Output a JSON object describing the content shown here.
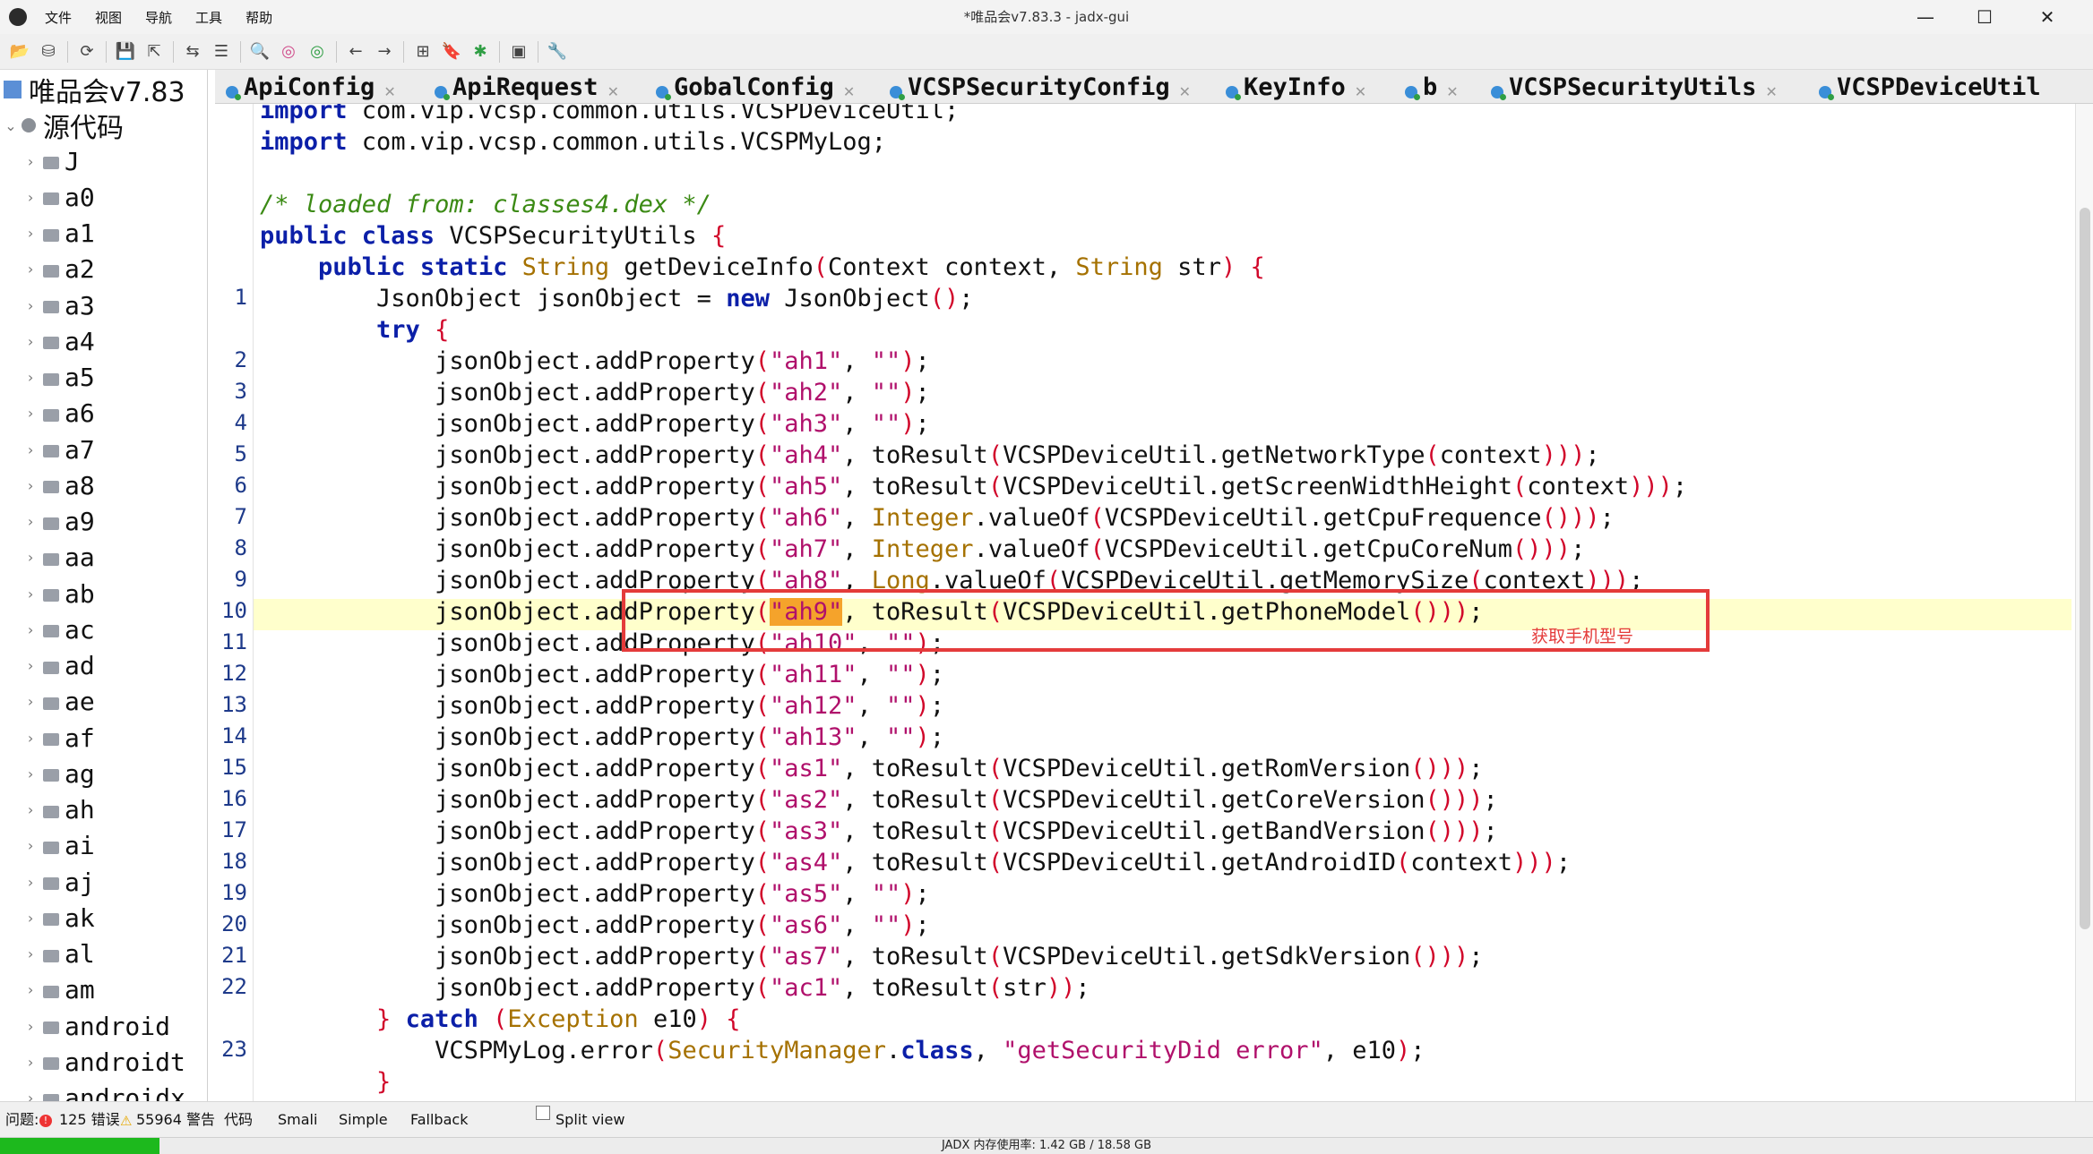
{
  "window": {
    "title": "*唯品会v7.83.3 - jadx-gui",
    "controls": {
      "minimize": "—",
      "maximize": "☐",
      "close": "✕"
    }
  },
  "menu": [
    "文件",
    "视图",
    "导航",
    "工具",
    "帮助"
  ],
  "toolbar_icons": [
    "open-file-icon",
    "save-all-icon",
    "reload-icon",
    "save-icon",
    "export-icon",
    "sync-icon",
    "flatten-icon",
    "search-icon",
    "find-usage-icon",
    "find-class-icon",
    "back-icon",
    "forward-icon",
    "deobfuscation-icon",
    "bookmark-icon",
    "debug-icon",
    "log-icon",
    "preferences-icon"
  ],
  "sidebar": {
    "root_label": "唯品会v7.83",
    "source_label": "源代码",
    "packages": [
      "J",
      "a0",
      "a1",
      "a2",
      "a3",
      "a4",
      "a5",
      "a6",
      "a7",
      "a8",
      "a9",
      "aa",
      "ab",
      "ac",
      "ad",
      "ae",
      "af",
      "ag",
      "ah",
      "ai",
      "aj",
      "ak",
      "al",
      "am",
      "android",
      "androidt",
      "androidx"
    ]
  },
  "tabs": [
    {
      "label": "ApiConfig"
    },
    {
      "label": "ApiRequest"
    },
    {
      "label": "GobalConfig"
    },
    {
      "label": "VCSPSecurityConfig"
    },
    {
      "label": "KeyInfo"
    },
    {
      "label": "b"
    },
    {
      "label": "VCSPSecurityUtils"
    },
    {
      "label": "VCSPDeviceUtil"
    }
  ],
  "line_numbers": [
    "1",
    "2",
    "3",
    "4",
    "5",
    "6",
    "7",
    "8",
    "9",
    "10",
    "11",
    "12",
    "13",
    "14",
    "15",
    "16",
    "17",
    "18",
    "19",
    "20",
    "21",
    "22",
    "23"
  ],
  "code": {
    "kw_import": "import",
    "import1_path": " com.vip.vcsp.common.utils.VCSPDeviceUtil;",
    "import2_path": " com.vip.vcsp.common.utils.VCSPMyLog;",
    "comment": "/* loaded from: classes4.dex */",
    "kw_public_class": "public class",
    "class_name": " VCSPSecurityUtils ",
    "kw_public_static": "public static",
    "type_string": "String",
    "type_context": "Context",
    "type_integer": "Integer",
    "type_long": "Long",
    "method_name": " getDeviceInfo",
    "param_context": " context, ",
    "param_str": " str",
    "local_decl": "JsonObject jsonObject = ",
    "kw_new": "new",
    "new_expr": " JsonObject",
    "kw_try": "try",
    "add_prop": "jsonObject.addProperty",
    "to_result": "toResult",
    "value_of": ".valueOf",
    "util_class": "VCSPDeviceUtil",
    "empty_str": "\"\"",
    "keys": {
      "ah1": "\"ah1\"",
      "ah2": "\"ah2\"",
      "ah3": "\"ah3\"",
      "ah4": "\"ah4\"",
      "ah5": "\"ah5\"",
      "ah6": "\"ah6\"",
      "ah7": "\"ah7\"",
      "ah8": "\"ah8\"",
      "ah9": "\"ah9\"",
      "ah10": "\"ah10\"",
      "ah11": "\"ah11\"",
      "ah12": "\"ah12\"",
      "ah13": "\"ah13\"",
      "as1": "\"as1\"",
      "as2": "\"as2\"",
      "as3": "\"as3\"",
      "as4": "\"as4\"",
      "as5": "\"as5\"",
      "as6": "\"as6\"",
      "as7": "\"as7\"",
      "ac1": "\"ac1\""
    },
    "calls": {
      "network": ".getNetworkType",
      "screen": ".getScreenWidthHeight",
      "cpu_freq": ".getCpuFrequence",
      "cpu_core": ".getCpuCoreNum",
      "memory": ".getMemorySize",
      "phone_model": ".getPhoneModel",
      "rom": ".getRomVersion",
      "core": ".getCoreVersion",
      "band": ".getBandVersion",
      "android_id": ".getAndroidID",
      "sdk": ".getSdkVersion"
    },
    "arg_context": "context",
    "arg_str": "str",
    "kw_catch": "catch",
    "type_exception": "Exception",
    "var_e10": " e10",
    "log_call": "VCSPMyLog.error",
    "sec_manager": "SecurityManager",
    "kw_class": "class",
    "err_msg": "\"getSecurityDid error\"",
    "e10_arg": ", e10"
  },
  "annotation": "获取手机型号",
  "bottom": {
    "issues_label": "问题:",
    "errors": "125 错误",
    "warnings": "55964 警告",
    "view_tabs": [
      "代码",
      "Smali",
      "Simple",
      "Fallback"
    ],
    "split_view": "Split view"
  },
  "status": {
    "memory": "JADX 内存使用率: 1.42 GB / 18.58 GB",
    "memory_fraction": 0.076
  },
  "colors": {
    "accent": "#3a8ed8",
    "highlight_box": "#e43b3b",
    "progress": "#1db91d"
  }
}
